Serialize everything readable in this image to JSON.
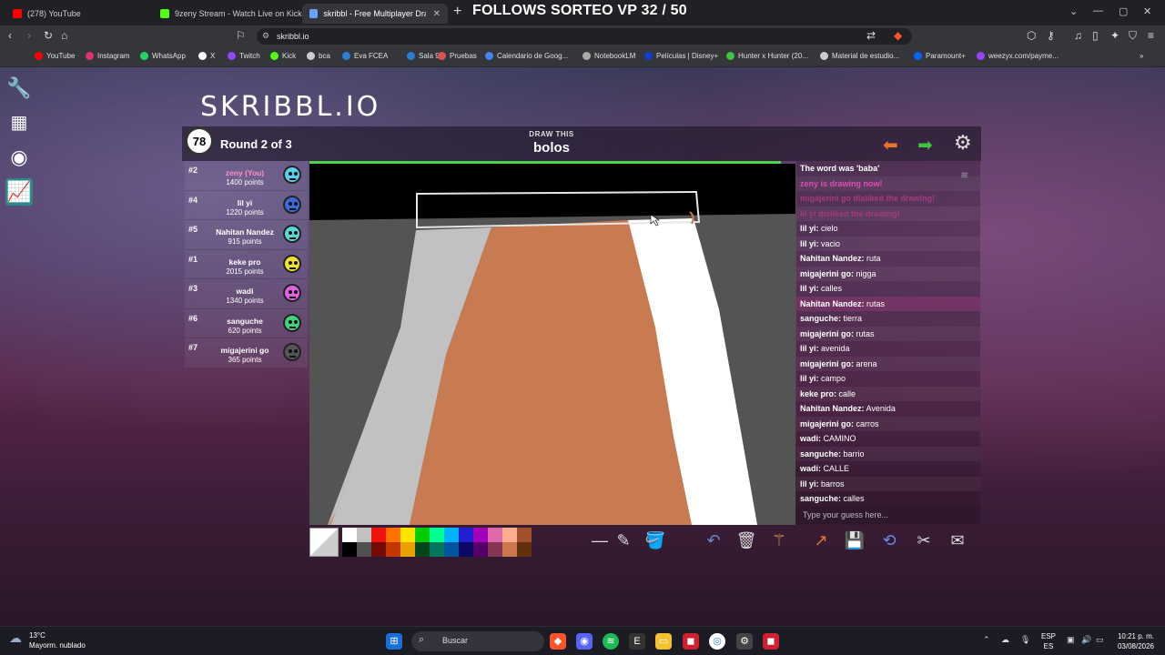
{
  "browser": {
    "tabs": [
      {
        "label": "(278) YouTube",
        "color": "#ff0000"
      },
      {
        "label": "9zeny Stream - Watch Live on Kick",
        "color": "#53fc18"
      },
      {
        "label": "skribbl - Free Multiplayer Drawing",
        "color": "#6aa0ff",
        "active": true
      }
    ],
    "overlay_title": "FOLLOWS SORTEO VP 32 / 50",
    "url": "skribbl.io",
    "bookmarks": [
      {
        "label": "YouTube",
        "color": "#ff0000"
      },
      {
        "label": "Instagram",
        "color": "#e1306c"
      },
      {
        "label": "WhatsApp",
        "color": "#25d366"
      },
      {
        "label": "X",
        "color": "#ffffff"
      },
      {
        "label": "Twitch",
        "color": "#9146ff"
      },
      {
        "label": "Kick",
        "color": "#53fc18"
      },
      {
        "label": "bca",
        "color": "#cccccc"
      },
      {
        "label": "Eva FCEA",
        "color": "#2a7fd4"
      },
      {
        "label": "Sala 9",
        "color": "#2a7fd4"
      },
      {
        "label": "Pruebas",
        "color": "#e05050"
      },
      {
        "label": "Calendario de Goog...",
        "color": "#4285f4"
      },
      {
        "label": "NotebookLM",
        "color": "#aaaaaa"
      },
      {
        "label": "Películas | Disney+",
        "color": "#113ccf"
      },
      {
        "label": "Hunter x Hunter (20...",
        "color": "#3ec43e"
      },
      {
        "label": "Material de estudio...",
        "color": "#cccccc"
      },
      {
        "label": "Paramount+",
        "color": "#0064ff"
      },
      {
        "label": "weezyx.com/payme...",
        "color": "#9a40ff"
      }
    ]
  },
  "game": {
    "logo": "SKRIBBL.IO",
    "timer": "78",
    "round": "Round 2 of 3",
    "draw_this": "DRAW THIS",
    "word": "bolos",
    "progress": 0.97
  },
  "players": [
    {
      "rank": "#2",
      "name": "zeny (You)",
      "points": "1400 points",
      "color": "#5ad0e8",
      "you": true
    },
    {
      "rank": "#4",
      "name": "lil yi",
      "points": "1220 points",
      "color": "#3a6ad8",
      "bubble": "barros"
    },
    {
      "rank": "#5",
      "name": "Nahitan Nandez",
      "points": "915 points",
      "color": "#5ad8d8"
    },
    {
      "rank": "#1",
      "name": "keke pro",
      "points": "2015 points",
      "color": "#f0e030"
    },
    {
      "rank": "#3",
      "name": "wadi",
      "points": "1340 points",
      "color": "#e060e0"
    },
    {
      "rank": "#6",
      "name": "sanguche",
      "points": "620 points",
      "color": "#40d080",
      "bubble": "calles"
    },
    {
      "rank": "#7",
      "name": "migajerini go",
      "points": "365 points",
      "color": "#555555"
    }
  ],
  "chat": [
    {
      "type": "sys-green",
      "text": "The word was 'baba'"
    },
    {
      "type": "sys-pink",
      "text": "zeny is drawing now!"
    },
    {
      "type": "sys-dis",
      "text": "migajerini go disliked the drawing!"
    },
    {
      "type": "sys-dis",
      "text": "lil yi disliked the drawing!"
    },
    {
      "who": "lil yi:",
      "text": "cielo"
    },
    {
      "who": "lil yi:",
      "text": "vacio"
    },
    {
      "who": "Nahitan Nandez:",
      "text": "ruta"
    },
    {
      "who": "migajerini go:",
      "text": "nigga"
    },
    {
      "who": "lil yi:",
      "text": "calles"
    },
    {
      "who": "Nahitan Nandez:",
      "text": "rutas",
      "hl": true
    },
    {
      "who": "sanguche:",
      "text": "tierra"
    },
    {
      "who": "migajerini go:",
      "text": "rutas"
    },
    {
      "who": "lil yi:",
      "text": "avenida"
    },
    {
      "who": "migajerini go:",
      "text": "arena"
    },
    {
      "who": "lil yi:",
      "text": "campo"
    },
    {
      "who": "keke pro:",
      "text": "calle"
    },
    {
      "who": "Nahitan Nandez:",
      "text": "Avenida"
    },
    {
      "who": "migajerini go:",
      "text": "carros"
    },
    {
      "who": "wadi:",
      "text": "CAMINO"
    },
    {
      "who": "sanguche:",
      "text": "barrio"
    },
    {
      "who": "wadi:",
      "text": "CALLE"
    },
    {
      "who": "lil yi:",
      "text": "barros"
    },
    {
      "who": "sanguche:",
      "text": "calles"
    }
  ],
  "guess_placeholder": "Type your guess here...",
  "palette": [
    "#ffffff",
    "#c1c1c1",
    "#ef130b",
    "#ff7100",
    "#ffe400",
    "#00cc00",
    "#00ff91",
    "#00b2ff",
    "#231fd3",
    "#a300ba",
    "#df69a7",
    "#ffac8e",
    "#a0522d",
    "#000000",
    "#505050",
    "#740b07",
    "#c23800",
    "#e8a200",
    "#004619",
    "#00785d",
    "#00569e",
    "#0e0865",
    "#550069",
    "#873554",
    "#cc774d",
    "#63300d"
  ],
  "taskbar": {
    "temp": "13°C",
    "weather": "Mayorm. nublado",
    "search": "Buscar",
    "lang1": "ESP",
    "lang2": "ES",
    "time": "10:21 p. m.",
    "date": "03/08/2026"
  }
}
